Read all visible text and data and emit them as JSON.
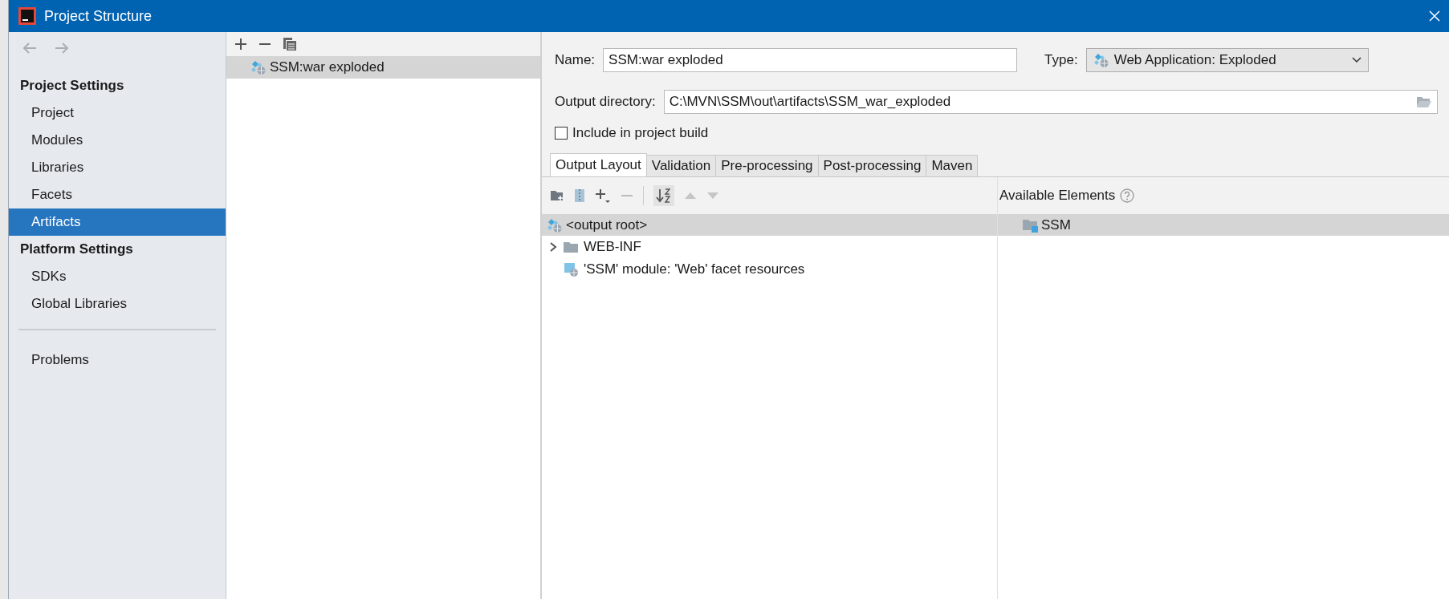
{
  "window": {
    "title": "Project Structure"
  },
  "sidebar": {
    "sections": [
      {
        "heading": "Project Settings",
        "items": [
          {
            "label": "Project",
            "selected": false
          },
          {
            "label": "Modules",
            "selected": false
          },
          {
            "label": "Libraries",
            "selected": false
          },
          {
            "label": "Facets",
            "selected": false
          },
          {
            "label": "Artifacts",
            "selected": true
          }
        ]
      },
      {
        "heading": "Platform Settings",
        "items": [
          {
            "label": "SDKs",
            "selected": false
          },
          {
            "label": "Global Libraries",
            "selected": false
          }
        ]
      }
    ],
    "footer_items": [
      {
        "label": "Problems",
        "selected": false
      }
    ]
  },
  "artifacts": {
    "items": [
      {
        "label": "SSM:war exploded",
        "selected": true
      }
    ]
  },
  "editor": {
    "name_label": "Name:",
    "name_value": "SSM:war exploded",
    "type_label": "Type:",
    "type_value": "Web Application: Exploded",
    "output_label": "Output directory:",
    "output_value": "C:\\MVN\\SSM\\out\\artifacts\\SSM_war_exploded",
    "include_build": {
      "label": "Include in project build",
      "checked": false
    },
    "tabs": [
      {
        "label": "Output Layout",
        "selected": true
      },
      {
        "label": "Validation",
        "selected": false
      },
      {
        "label": "Pre-processing",
        "selected": false
      },
      {
        "label": "Post-processing",
        "selected": false
      },
      {
        "label": "Maven",
        "selected": false
      }
    ],
    "layout_tree": [
      {
        "label": "<output root>",
        "kind": "root",
        "selected": true,
        "children": [
          {
            "label": "WEB-INF",
            "kind": "folder",
            "expanded": false,
            "selected": false
          },
          {
            "label": "'SSM' module: 'Web' facet resources",
            "kind": "facet",
            "selected": false
          }
        ]
      }
    ],
    "available": {
      "title": "Available Elements",
      "items": [
        {
          "label": "SSM",
          "kind": "module",
          "selected": true
        }
      ]
    }
  }
}
